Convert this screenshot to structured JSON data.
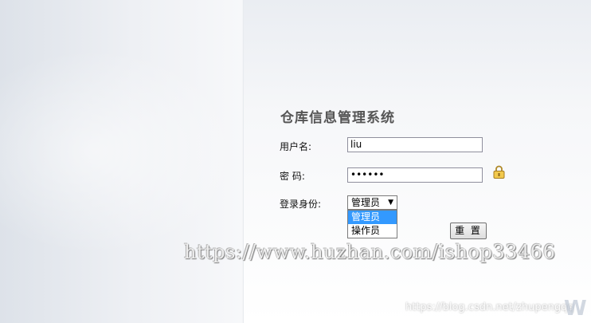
{
  "title": "仓库信息管理系统",
  "form": {
    "username_label": "用户名:",
    "username_value": "liu",
    "password_label": "密 码:",
    "password_value": "••••••",
    "role_label": "登录身份:",
    "role_selected": "管理员",
    "role_options": [
      "管理员",
      "操作员"
    ],
    "reset_label": "重 置"
  },
  "icons": {
    "lock": "lock-icon",
    "dropdown_arrow": "▼"
  },
  "colors": {
    "option_highlight": "#3399ff",
    "title": "#555555"
  },
  "watermarks": {
    "huzhan": "https://www.huzhan.com/ishop33466",
    "csdn": "https://blog.csdn.net/zhupengqq"
  }
}
